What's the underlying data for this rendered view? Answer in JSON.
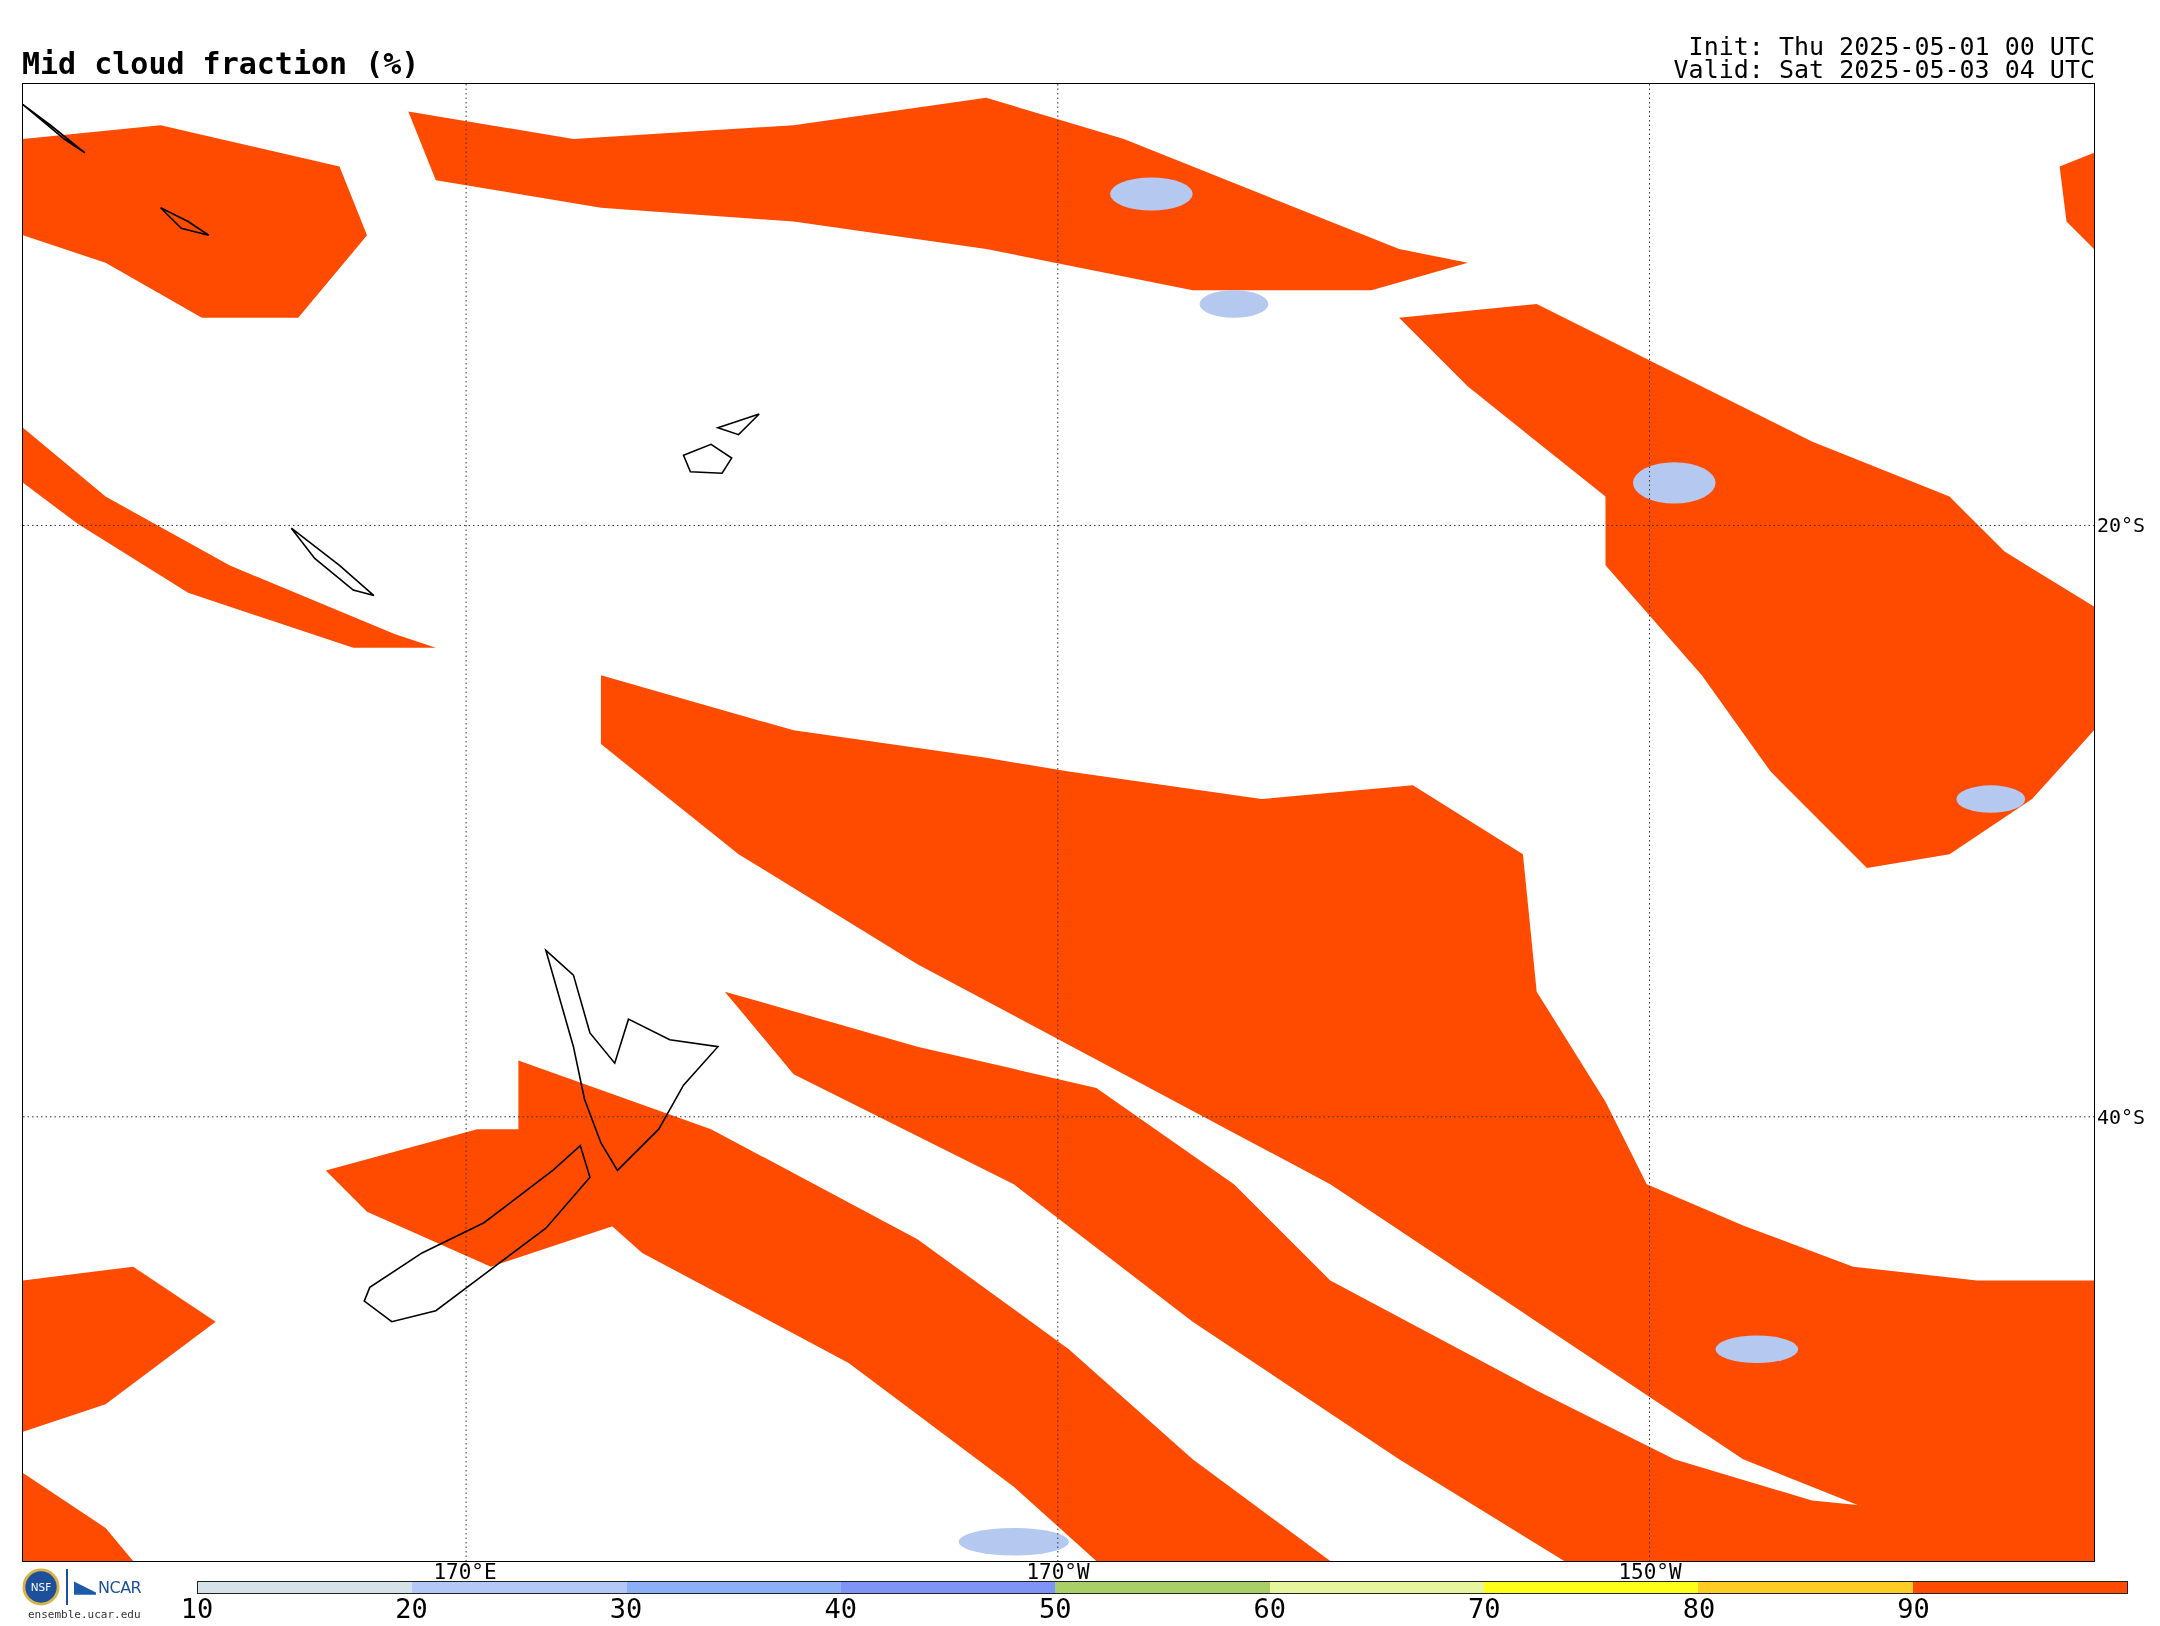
{
  "title": "Mid cloud fraction (%)",
  "init": "Init: Thu 2025-05-01 00 UTC",
  "valid": "Valid: Sat 2025-05-03 04 UTC",
  "map": {
    "lat_labels": [
      "20°S",
      "40°S"
    ],
    "lon_labels": [
      "170°E",
      "170°W",
      "150°W"
    ]
  },
  "logos": {
    "seal": "NSF",
    "org": "NCAR",
    "url": "ensemble.ucar.edu"
  },
  "colorbar": {
    "bins": [
      {
        "label": "10",
        "color": "#d6e2ea"
      },
      {
        "label": "20",
        "color": "#b4c8f8"
      },
      {
        "label": "30",
        "color": "#8cb0f8"
      },
      {
        "label": "40",
        "color": "#7e94f6"
      },
      {
        "label": "50",
        "color": "#a8cf68"
      },
      {
        "label": "60",
        "color": "#e6f59e"
      },
      {
        "label": "70",
        "color": "#ffff1a"
      },
      {
        "label": "80",
        "color": "#fdcd25"
      },
      {
        "label": "90",
        "color": "#ff4b00"
      }
    ]
  }
}
